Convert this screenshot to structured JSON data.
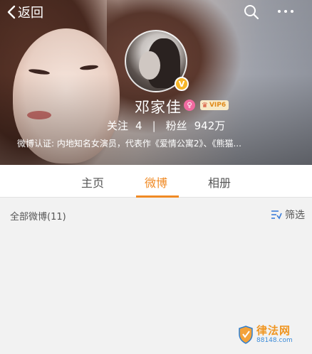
{
  "topbar": {
    "back_label": "返回",
    "icons": [
      "chevron-left-icon",
      "search-icon",
      "more-dots-icon"
    ]
  },
  "profile": {
    "name": "邓家佳",
    "gender_symbol": "♀",
    "verified_badge": "V",
    "vip_label": "VIP6",
    "following_label": "关注",
    "following_count": "4",
    "followers_label": "粉丝",
    "followers_count": "942万",
    "separator": "|",
    "verification": "微博认证: 内地知名女演员，代表作《爱情公寓2》、《熊猫..."
  },
  "tabs": [
    {
      "label": "主页",
      "active": false
    },
    {
      "label": "微博",
      "active": true
    },
    {
      "label": "相册",
      "active": false
    }
  ],
  "feed": {
    "all_label": "全部微博(11)",
    "filter_label": "筛选"
  },
  "watermark": {
    "title": "律法网",
    "sub": "88148.com"
  },
  "colors": {
    "accent": "#f08a24",
    "background": "#f2f2f2",
    "vbadge": "#f5b52a",
    "gender_badge": "#f06aa0"
  }
}
